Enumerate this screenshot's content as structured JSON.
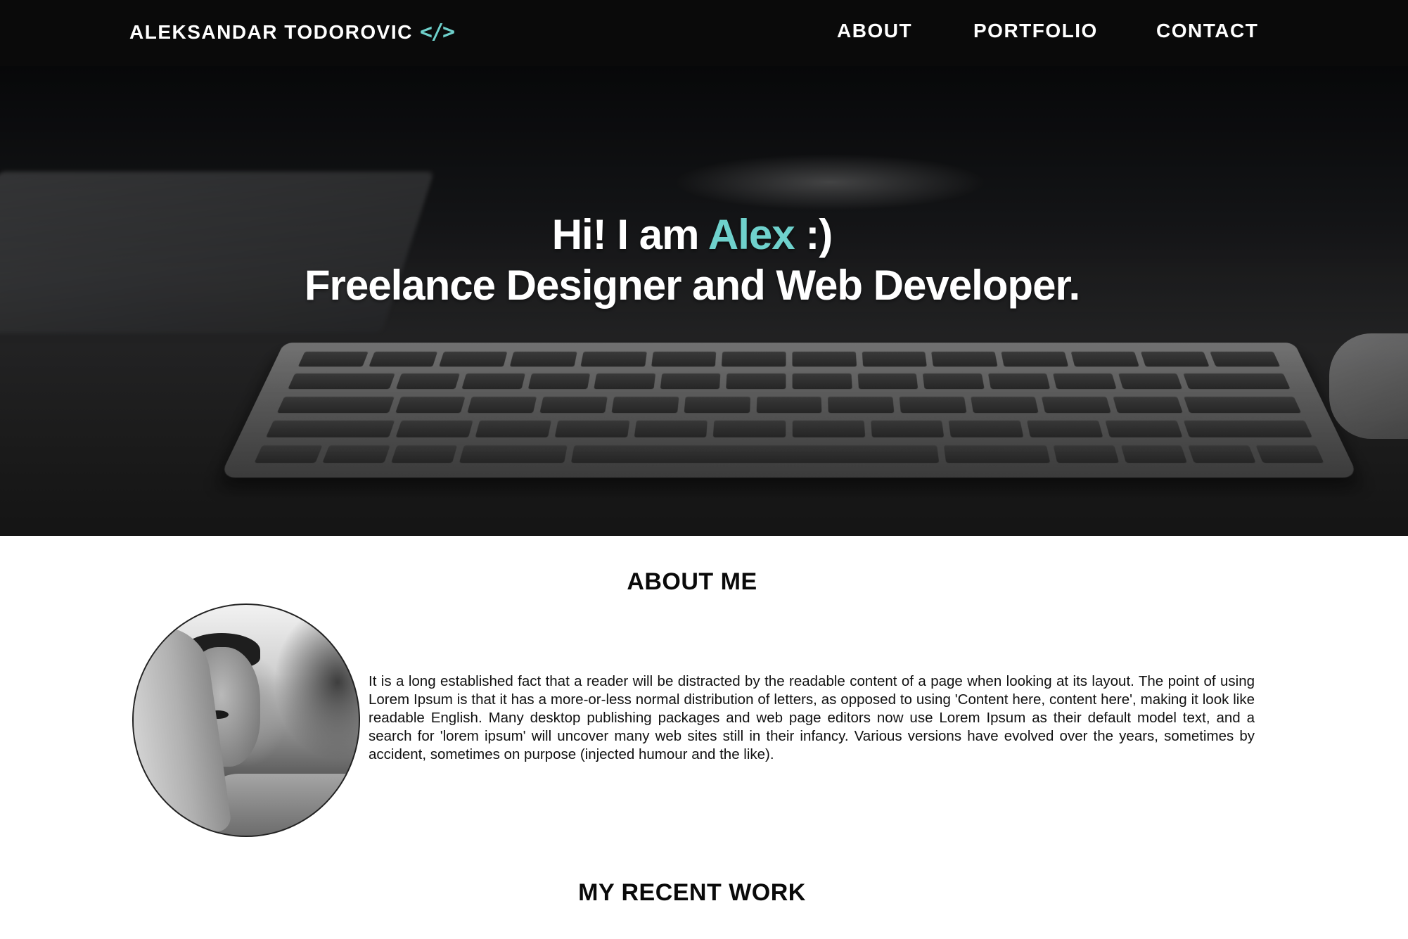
{
  "navbar": {
    "brand": "ALEKSANDAR TODOROVIC",
    "brand_icon": "code-icon",
    "links": [
      {
        "label": "ABOUT"
      },
      {
        "label": "PORTFOLIO"
      },
      {
        "label": "CONTACT"
      }
    ]
  },
  "hero": {
    "greeting_prefix": "Hi! I am",
    "name": "Alex",
    "greeting_suffix": ":)",
    "tagline": "Freelance Designer and Web Developer."
  },
  "about": {
    "title": "ABOUT ME",
    "body": "It is a long established fact that a reader will be distracted by the readable content of a page when looking at its layout. The point of using Lorem Ipsum is that it has a more-or-less normal distribution of letters, as opposed to using 'Content here, content here', making it look like readable English. Many desktop publishing packages and web page editors now use Lorem Ipsum as their default model text, and a search for 'lorem ipsum' will uncover many web sites still in their infancy. Various versions have evolved over the years, sometimes by accident, sometimes on purpose (injected humour and the like)."
  },
  "work": {
    "title": "MY RECENT WORK"
  },
  "colors": {
    "accent": "#6fd1cc",
    "navbar_bg": "#0a0a0a",
    "text": "#0a0a0a"
  }
}
